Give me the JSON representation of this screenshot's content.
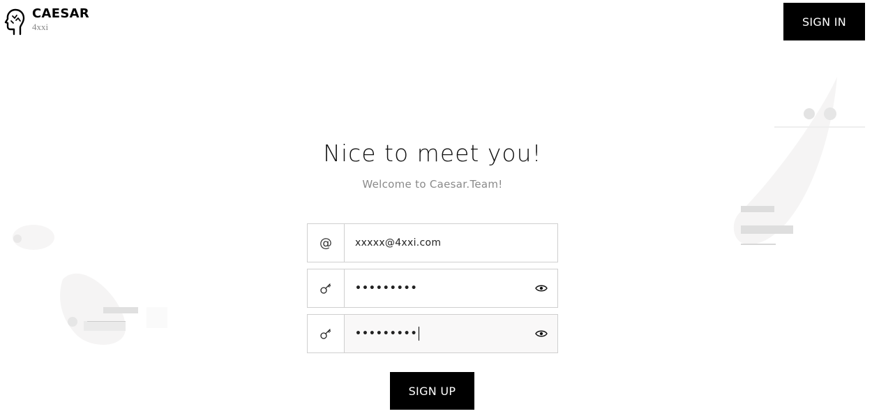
{
  "header": {
    "brand": "CAESAR",
    "sub": "4xxi",
    "sign_in_label": "SIGN IN",
    "logo_icon": "head-profile-icon"
  },
  "main": {
    "headline": "Nice to meet you!",
    "subline": "Welcome to Caesar.Team!"
  },
  "form": {
    "email": {
      "icon": "at-icon",
      "icon_glyph": "@",
      "value": "xxxxx@4xxi.com"
    },
    "password": {
      "icon": "key-icon",
      "value": "•••••••••",
      "toggle_icon": "eye-icon"
    },
    "confirm_password": {
      "icon": "key-icon",
      "value": "•••••••••",
      "toggle_icon": "eye-icon"
    },
    "sign_up_label": "SIGN UP"
  },
  "colors": {
    "primary": "#000000",
    "border": "#cfcfcf",
    "muted_text": "#8a8a8a",
    "active_field_bg": "#f9f8f8"
  }
}
